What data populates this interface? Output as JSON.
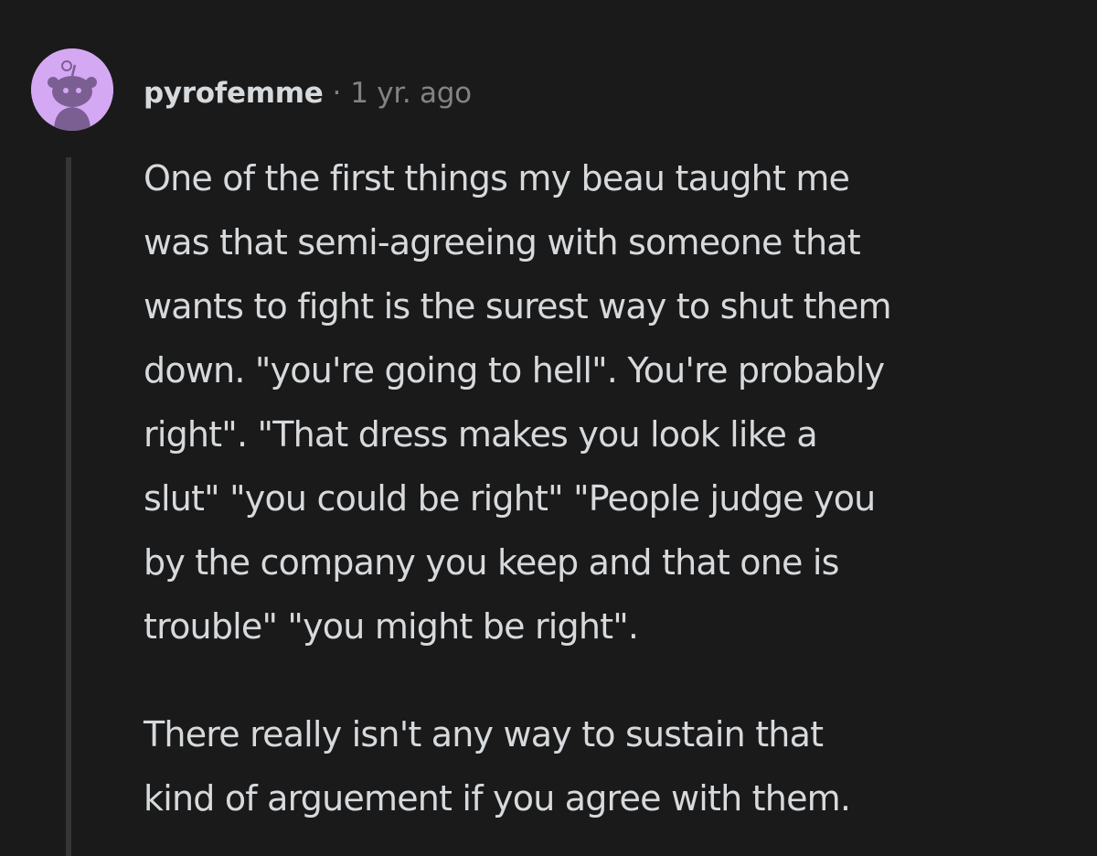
{
  "comment": {
    "username": "pyrofemme",
    "separator": "·",
    "timestamp": "1 yr. ago",
    "avatar_icon": "snoo-avatar-icon",
    "colors": {
      "background": "#1a1a1b",
      "avatar_bg": "#d5a8f4",
      "text": "#d7dadc",
      "muted": "#818384",
      "thread_line": "#343536"
    },
    "paragraphs": [
      {
        "lines": [
          "One of the first things my beau taught me",
          "was that semi-agreeing with someone that",
          "wants to fight is the surest way to shut them",
          "down. \"you're going to hell\". You're probably",
          "right\". \"That dress makes you look like a",
          "slut\" \"you could be right\" \"People judge you",
          "by the company you keep and that one is",
          "trouble\" \"you might be right\"."
        ]
      },
      {
        "lines": [
          "There really isn't any way to sustain that",
          "kind of arguement if you agree with them."
        ]
      }
    ]
  }
}
